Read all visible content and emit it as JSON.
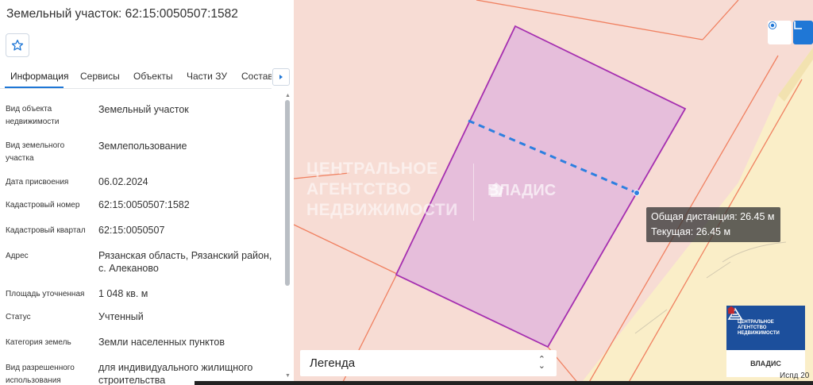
{
  "panel": {
    "title": "Земельный участок: 62:15:0050507:1582",
    "tabs": [
      {
        "label": "Информация",
        "active": true
      },
      {
        "label": "Сервисы"
      },
      {
        "label": "Объекты"
      },
      {
        "label": "Части ЗУ"
      },
      {
        "label": "Состав"
      }
    ],
    "fields": [
      {
        "label": "Вид объекта недвижимости",
        "value": "Земельный участок"
      },
      {
        "label": "Вид земельного участка",
        "value": "Землепользование"
      },
      {
        "label": "Дата присвоения",
        "value": "06.02.2024"
      },
      {
        "label": "Кадастровый номер",
        "value": "62:15:0050507:1582"
      },
      {
        "label": "Кадастровый квартал",
        "value": "62:15:0050507"
      },
      {
        "label": "Адрес",
        "value": "Рязанская область, Рязанский район, с. Алеканово"
      },
      {
        "label": "Площадь уточненная",
        "value": "1 048 кв. м"
      },
      {
        "label": "Статус",
        "value": "Учтенный"
      },
      {
        "label": "Категория земель",
        "value": "Земли населенных пунктов"
      },
      {
        "label": "Вид разрешенного использования",
        "value": "для индивидуального жилищного строительства"
      }
    ]
  },
  "map": {
    "watermark": {
      "line1": "ЦЕНТРАЛЬНОЕ",
      "line2": "АГЕНТСТВО",
      "line3": "НЕДВИЖИМОСТИ",
      "logo": "ВЛАДИС"
    },
    "tooltip": {
      "total": "Общая дистанция: 26.45 м",
      "current": "Текущая: 26.45 м"
    },
    "legend": {
      "label": "Легенда"
    },
    "brand": {
      "line1": "ЦЕНТРАЛЬНОЕ",
      "line2": "АГЕНТСТВО",
      "line3": "НЕДВИЖИМОСТИ",
      "logo": "ВЛАДИС"
    },
    "cut_text": "Испд 20",
    "controls": {
      "locate_icon": "target-icon",
      "measure_icon": "ruler-icon"
    },
    "colors": {
      "parcel_fill": "#e6bedb",
      "parcel_stroke": "#a52fb0",
      "boundary": "#f08060",
      "road": "#faeec8",
      "measure": "#2d7fe0",
      "accent": "#1f77d6"
    }
  }
}
